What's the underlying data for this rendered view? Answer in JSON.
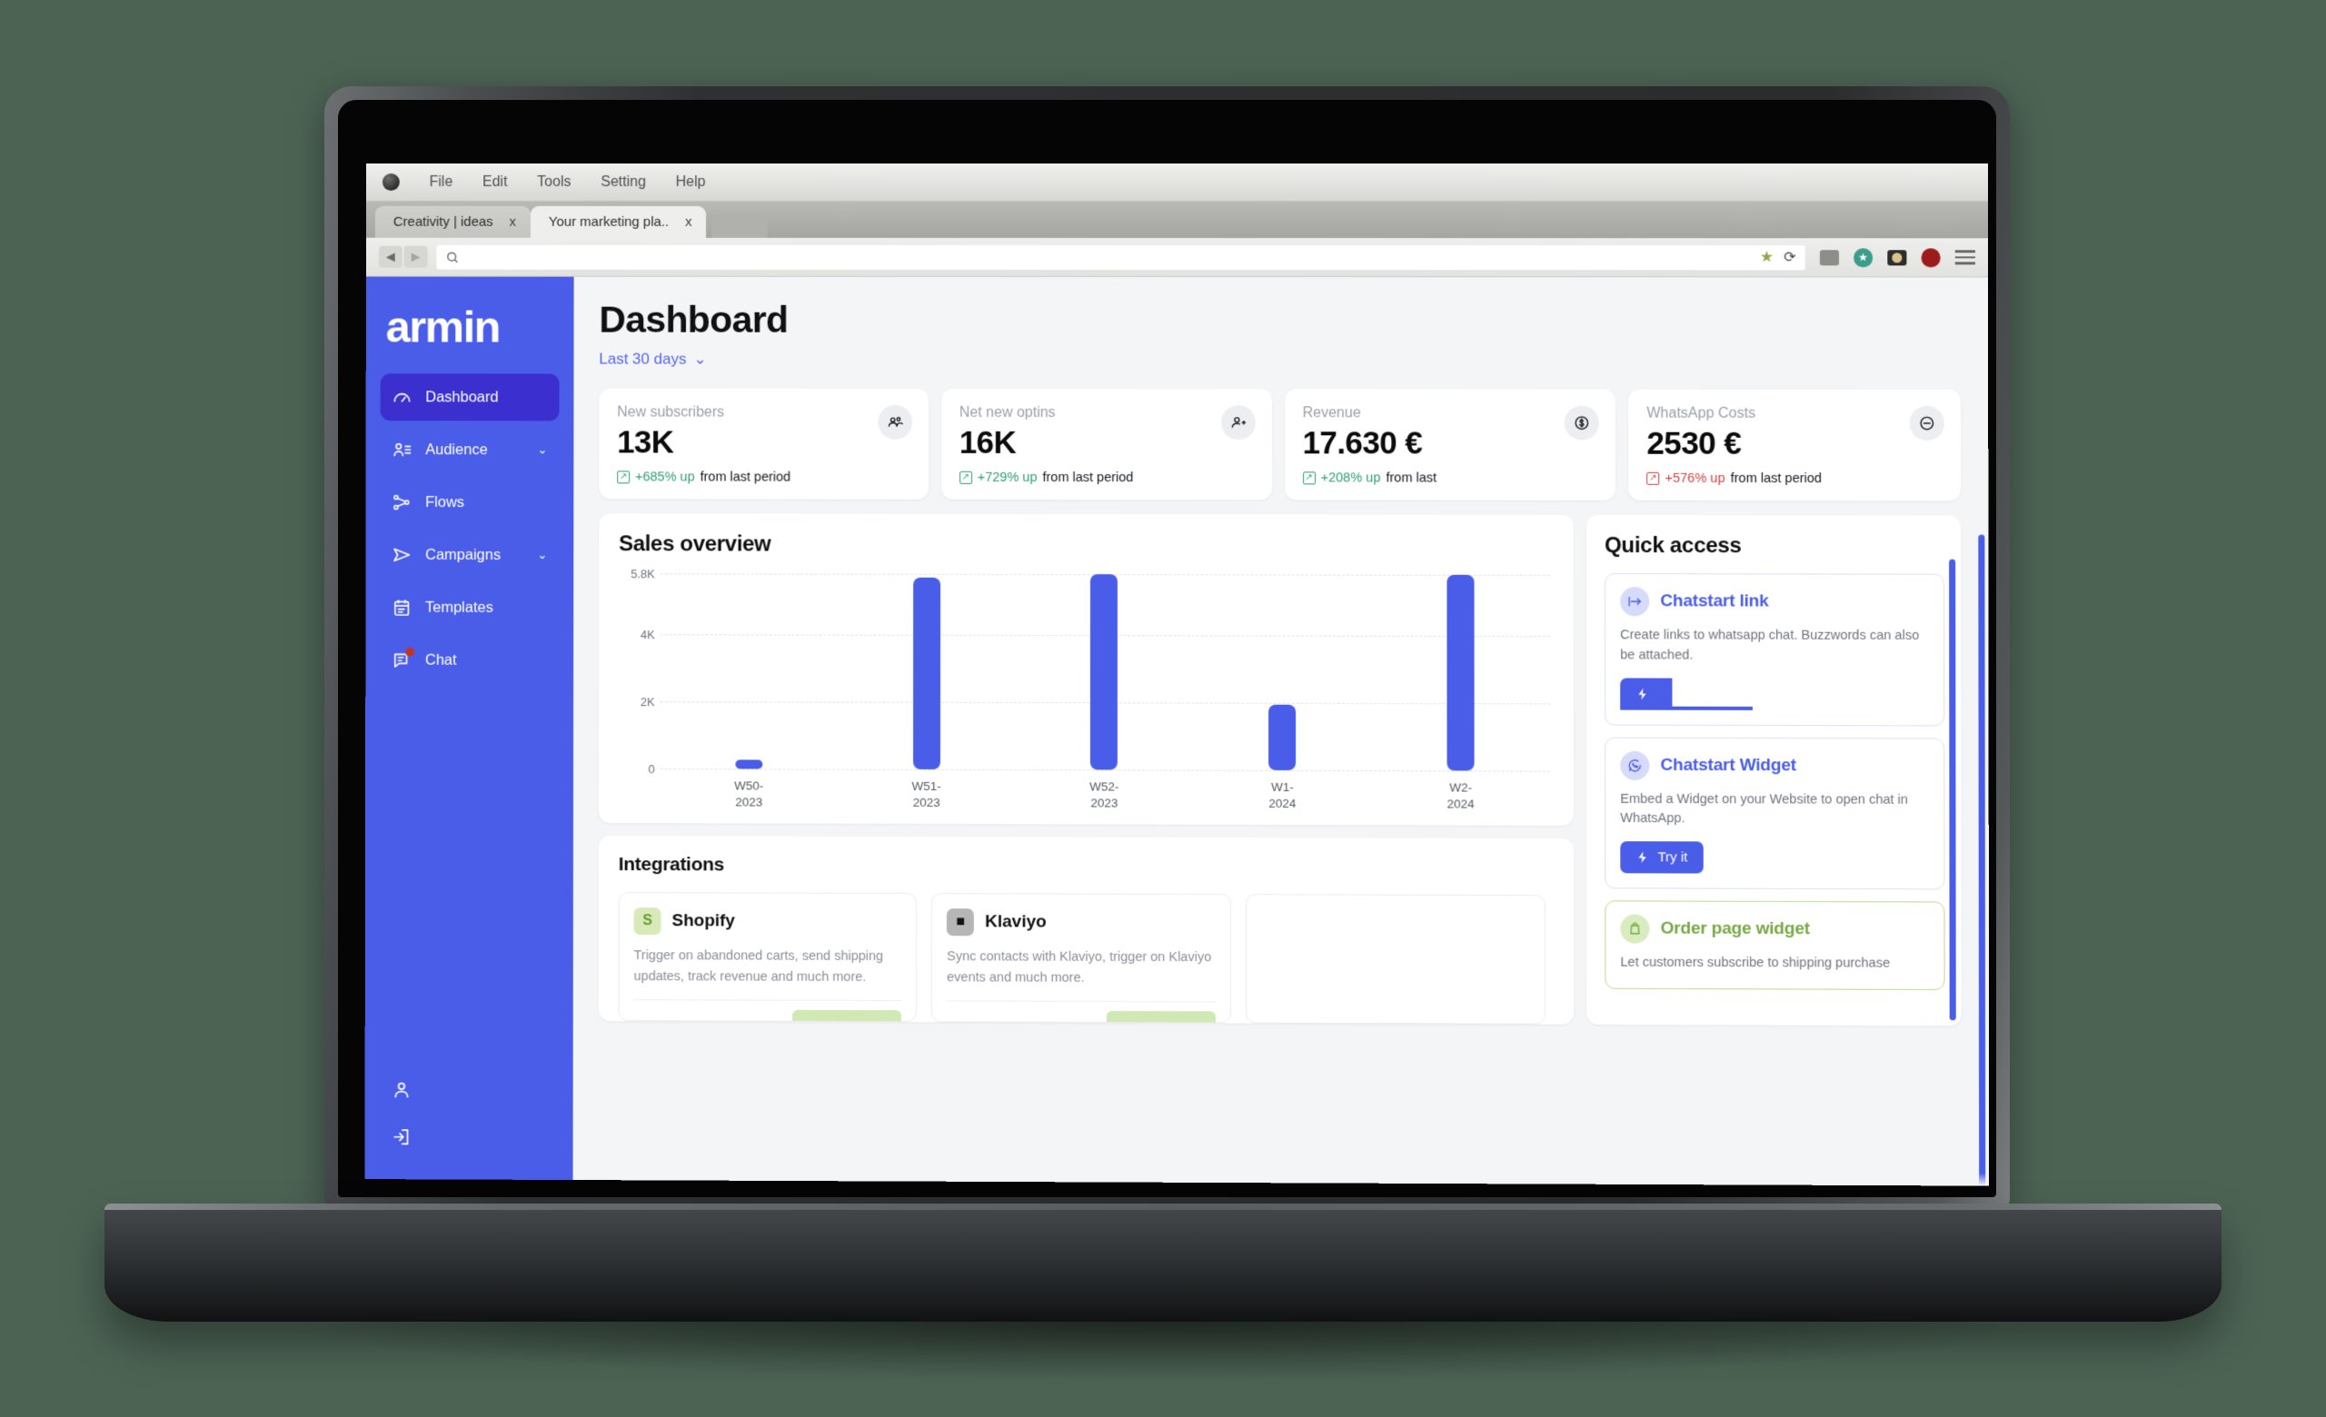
{
  "browser": {
    "menu": [
      "File",
      "Edit",
      "Tools",
      "Setting",
      "Help"
    ],
    "tabs": [
      {
        "label": "Creativity | ideas",
        "close": "x",
        "active": false
      },
      {
        "label": "Your marketing pla..",
        "close": "x",
        "active": true
      }
    ],
    "nav": {
      "back": "◀",
      "forward": "▶"
    },
    "url_value": "",
    "url_placeholder": ""
  },
  "sidebar": {
    "brand": "armin",
    "items": [
      {
        "label": "Dashboard",
        "icon": "gauge-icon",
        "active": true,
        "caret": false,
        "badge": false
      },
      {
        "label": "Audience",
        "icon": "contacts-icon",
        "active": false,
        "caret": true,
        "badge": false
      },
      {
        "label": "Flows",
        "icon": "flows-icon",
        "active": false,
        "caret": false,
        "badge": false
      },
      {
        "label": "Campaigns",
        "icon": "send-icon",
        "active": false,
        "caret": true,
        "badge": false
      },
      {
        "label": "Templates",
        "icon": "clipboard-icon",
        "active": false,
        "caret": false,
        "badge": false
      },
      {
        "label": "Chat",
        "icon": "chat-icon",
        "active": false,
        "caret": false,
        "badge": true
      }
    ],
    "bottom": [
      {
        "icon": "user-icon",
        "label": "Account"
      },
      {
        "icon": "logout-icon",
        "label": "Log out"
      }
    ],
    "caret_glyph": "⌄"
  },
  "header": {
    "title": "Dashboard",
    "date_filter": "Last 30 days",
    "date_filter_caret": "⌄"
  },
  "kpis": [
    {
      "label": "New subscribers",
      "value": "13K",
      "delta_pct": "+685% up",
      "delta_tail": "from last period",
      "direction": "up",
      "icon": "people-icon"
    },
    {
      "label": "Net new optins",
      "value": "16K",
      "delta_pct": "+729% up",
      "delta_tail": "from last period",
      "direction": "up",
      "icon": "person-add-icon"
    },
    {
      "label": "Revenue",
      "value": "17.630 €",
      "delta_pct": "+208% up",
      "delta_tail": "from last ",
      "direction": "up",
      "icon": "dollar-icon"
    },
    {
      "label": "WhatsApp Costs",
      "value": "2530 €",
      "delta_pct": "+576% up",
      "delta_tail": "from last period",
      "direction": "down",
      "icon": "minus-circle-icon"
    }
  ],
  "sales": {
    "title": "Sales overview"
  },
  "chart_data": {
    "type": "bar",
    "title": "Sales overview",
    "categories": [
      "W50-2023",
      "W51-2023",
      "W52-2023",
      "W1-2024",
      "W2-2024"
    ],
    "category_lines": [
      [
        "W50-",
        "2023"
      ],
      [
        "W51-",
        "2023"
      ],
      [
        "W52-",
        "2023"
      ],
      [
        "W1-",
        "2024"
      ],
      [
        "W2-",
        "2024"
      ]
    ],
    "values": [
      120,
      5700,
      5800,
      1950,
      5800
    ],
    "ytick_labels": [
      "5.8K",
      "4K",
      "2K",
      "0"
    ],
    "ytick_values": [
      5800,
      4000,
      2000,
      0
    ],
    "ylim": [
      0,
      5800
    ],
    "xlabel": "",
    "ylabel": "",
    "grid": true,
    "legend": false,
    "bar_color": "#4a5de8"
  },
  "integrations": {
    "title": "Integrations",
    "cards": [
      {
        "name": "Shopify",
        "logo": "shopify-icon",
        "desc": "Trigger on abandoned carts, send shipping updates, track revenue and much more."
      },
      {
        "name": "Klaviyo",
        "logo": "klaviyo-icon",
        "desc": "Sync contacts with Klaviyo, trigger on Klaviyo events and much more."
      }
    ]
  },
  "quick_access": {
    "title": "Quick access",
    "items": [
      {
        "title": "Chatstart link",
        "icon": "link-arrow-icon",
        "desc": "Create links to whatsapp chat. Buzzwords can also be attached.",
        "button": "",
        "theme": "blue",
        "button_clipped": true
      },
      {
        "title": "Chatstart Widget",
        "icon": "whatsapp-icon",
        "desc": "Embed a Widget on your Website to open chat in WhatsApp.",
        "button": "Try it",
        "theme": "blue",
        "button_clipped": false
      },
      {
        "title": "Order page widget",
        "icon": "shopify-bag-icon",
        "desc": "Let customers subscribe to shipping purchase",
        "button": "",
        "theme": "green",
        "button_clipped": false
      }
    ]
  },
  "colors": {
    "brand_blue": "#4a5de8",
    "sidebar_active": "#3b30cf",
    "green": "#76a845",
    "up_green": "#2e9e72",
    "down_red": "#d14343",
    "page_bg": "#f4f5f7"
  }
}
